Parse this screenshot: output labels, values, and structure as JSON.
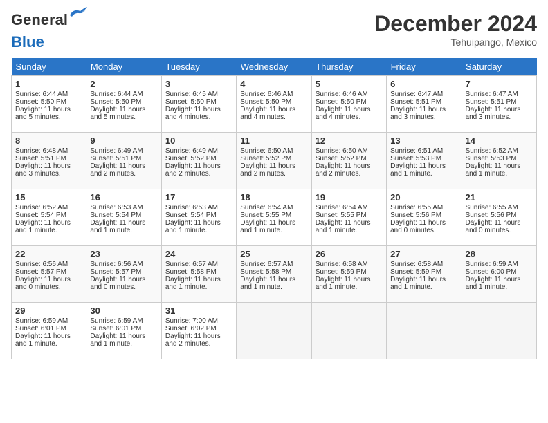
{
  "header": {
    "logo_line1": "General",
    "logo_line2": "Blue",
    "month": "December 2024",
    "location": "Tehuipango, Mexico"
  },
  "days_of_week": [
    "Sunday",
    "Monday",
    "Tuesday",
    "Wednesday",
    "Thursday",
    "Friday",
    "Saturday"
  ],
  "weeks": [
    [
      {
        "day": 1,
        "info": "Sunrise: 6:44 AM\nSunset: 5:50 PM\nDaylight: 11 hours\nand 5 minutes."
      },
      {
        "day": 2,
        "info": "Sunrise: 6:44 AM\nSunset: 5:50 PM\nDaylight: 11 hours\nand 5 minutes."
      },
      {
        "day": 3,
        "info": "Sunrise: 6:45 AM\nSunset: 5:50 PM\nDaylight: 11 hours\nand 4 minutes."
      },
      {
        "day": 4,
        "info": "Sunrise: 6:46 AM\nSunset: 5:50 PM\nDaylight: 11 hours\nand 4 minutes."
      },
      {
        "day": 5,
        "info": "Sunrise: 6:46 AM\nSunset: 5:50 PM\nDaylight: 11 hours\nand 4 minutes."
      },
      {
        "day": 6,
        "info": "Sunrise: 6:47 AM\nSunset: 5:51 PM\nDaylight: 11 hours\nand 3 minutes."
      },
      {
        "day": 7,
        "info": "Sunrise: 6:47 AM\nSunset: 5:51 PM\nDaylight: 11 hours\nand 3 minutes."
      }
    ],
    [
      {
        "day": 8,
        "info": "Sunrise: 6:48 AM\nSunset: 5:51 PM\nDaylight: 11 hours\nand 3 minutes."
      },
      {
        "day": 9,
        "info": "Sunrise: 6:49 AM\nSunset: 5:51 PM\nDaylight: 11 hours\nand 2 minutes."
      },
      {
        "day": 10,
        "info": "Sunrise: 6:49 AM\nSunset: 5:52 PM\nDaylight: 11 hours\nand 2 minutes."
      },
      {
        "day": 11,
        "info": "Sunrise: 6:50 AM\nSunset: 5:52 PM\nDaylight: 11 hours\nand 2 minutes."
      },
      {
        "day": 12,
        "info": "Sunrise: 6:50 AM\nSunset: 5:52 PM\nDaylight: 11 hours\nand 2 minutes."
      },
      {
        "day": 13,
        "info": "Sunrise: 6:51 AM\nSunset: 5:53 PM\nDaylight: 11 hours\nand 1 minute."
      },
      {
        "day": 14,
        "info": "Sunrise: 6:52 AM\nSunset: 5:53 PM\nDaylight: 11 hours\nand 1 minute."
      }
    ],
    [
      {
        "day": 15,
        "info": "Sunrise: 6:52 AM\nSunset: 5:54 PM\nDaylight: 11 hours\nand 1 minute."
      },
      {
        "day": 16,
        "info": "Sunrise: 6:53 AM\nSunset: 5:54 PM\nDaylight: 11 hours\nand 1 minute."
      },
      {
        "day": 17,
        "info": "Sunrise: 6:53 AM\nSunset: 5:54 PM\nDaylight: 11 hours\nand 1 minute."
      },
      {
        "day": 18,
        "info": "Sunrise: 6:54 AM\nSunset: 5:55 PM\nDaylight: 11 hours\nand 1 minute."
      },
      {
        "day": 19,
        "info": "Sunrise: 6:54 AM\nSunset: 5:55 PM\nDaylight: 11 hours\nand 1 minute."
      },
      {
        "day": 20,
        "info": "Sunrise: 6:55 AM\nSunset: 5:56 PM\nDaylight: 11 hours\nand 0 minutes."
      },
      {
        "day": 21,
        "info": "Sunrise: 6:55 AM\nSunset: 5:56 PM\nDaylight: 11 hours\nand 0 minutes."
      }
    ],
    [
      {
        "day": 22,
        "info": "Sunrise: 6:56 AM\nSunset: 5:57 PM\nDaylight: 11 hours\nand 0 minutes."
      },
      {
        "day": 23,
        "info": "Sunrise: 6:56 AM\nSunset: 5:57 PM\nDaylight: 11 hours\nand 0 minutes."
      },
      {
        "day": 24,
        "info": "Sunrise: 6:57 AM\nSunset: 5:58 PM\nDaylight: 11 hours\nand 1 minute."
      },
      {
        "day": 25,
        "info": "Sunrise: 6:57 AM\nSunset: 5:58 PM\nDaylight: 11 hours\nand 1 minute."
      },
      {
        "day": 26,
        "info": "Sunrise: 6:58 AM\nSunset: 5:59 PM\nDaylight: 11 hours\nand 1 minute."
      },
      {
        "day": 27,
        "info": "Sunrise: 6:58 AM\nSunset: 5:59 PM\nDaylight: 11 hours\nand 1 minute."
      },
      {
        "day": 28,
        "info": "Sunrise: 6:59 AM\nSunset: 6:00 PM\nDaylight: 11 hours\nand 1 minute."
      }
    ],
    [
      {
        "day": 29,
        "info": "Sunrise: 6:59 AM\nSunset: 6:01 PM\nDaylight: 11 hours\nand 1 minute."
      },
      {
        "day": 30,
        "info": "Sunrise: 6:59 AM\nSunset: 6:01 PM\nDaylight: 11 hours\nand 1 minute."
      },
      {
        "day": 31,
        "info": "Sunrise: 7:00 AM\nSunset: 6:02 PM\nDaylight: 11 hours\nand 2 minutes."
      },
      null,
      null,
      null,
      null
    ]
  ]
}
